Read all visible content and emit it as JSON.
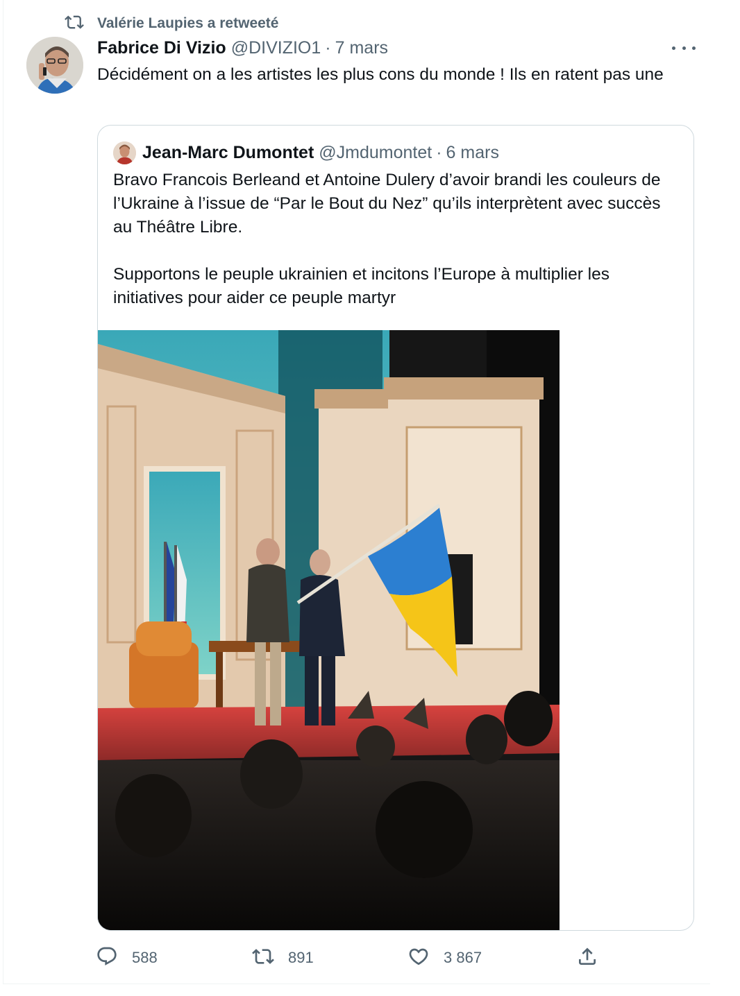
{
  "retweet": {
    "label": "Valérie Laupies a retweeté"
  },
  "tweet": {
    "author_name": "Fabrice Di Vizio",
    "handle": "@DIVIZIO1",
    "separator": "·",
    "date": "7 mars",
    "text": "Décidément on a les artistes les plus cons du monde ! Ils en ratent pas une"
  },
  "quote": {
    "author_name": "Jean-Marc Dumontet",
    "handle": "@Jmdumontet",
    "separator": "·",
    "date": "6 mars",
    "text": "Bravo Francois Berleand et Antoine Dulery d’avoir brandi les couleurs de l’Ukraine à l’issue de “Par le Bout du Nez”  qu’ils interprètent avec succès au Théâtre Libre.\n\nSupportons le peuple ukrainien et incitons l’Europe à multiplier les initiatives pour aider ce peuple martyr"
  },
  "actions": {
    "replies": "588",
    "retweets": "891",
    "likes": "3 867"
  },
  "icons": {
    "retweet": "retweet-icon",
    "more": "more-icon",
    "reply": "reply-icon",
    "like": "heart-icon",
    "share": "share-icon"
  },
  "colors": {
    "secondary_text": "#536471",
    "border": "#cfd9de",
    "ukraine_blue": "#2c7fd1",
    "ukraine_yellow": "#f5c518"
  }
}
